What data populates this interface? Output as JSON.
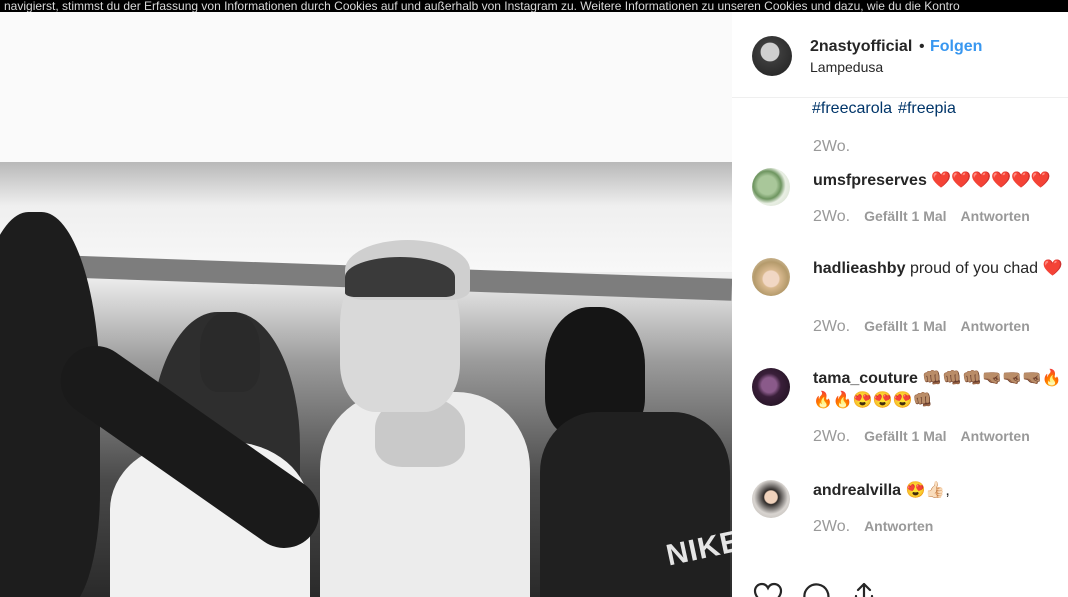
{
  "cookie_banner": {
    "text": "navigierst, stimmst du der Erfassung von Informationen durch Cookies auf und außerhalb von Instagram zu. Weitere Informationen zu unseren Cookies und dazu, wie du die Kontro"
  },
  "photo": {
    "shirt_text": "NIKE"
  },
  "post": {
    "username": "2nastyofficial",
    "separator": "•",
    "follow_label": "Folgen",
    "location": "Lampedusa"
  },
  "caption": {
    "hashtags": [
      "#freecarola",
      "#freepia"
    ],
    "time": "2Wo."
  },
  "comments": [
    {
      "username": "umsfpreserves",
      "text": "❤️❤️❤️❤️❤️❤️",
      "time": "2Wo.",
      "likes": "Gefällt 1 Mal",
      "reply": "Antworten"
    },
    {
      "username": "hadlieashby",
      "text": "proud of you chad ❤️",
      "time": "2Wo.",
      "likes": "Gefällt 1 Mal",
      "reply": "Antworten"
    },
    {
      "username": "tama_couture",
      "text": "👊🏽👊🏽👊🏽🤜🏽🤜🏽🤜🏽🔥🔥🔥😍😍😍👊🏽",
      "time": "2Wo.",
      "likes": "Gefällt 1 Mal",
      "reply": "Antworten"
    },
    {
      "username": "andrealvilla",
      "text": "😍👍🏻,",
      "time": "2Wo.",
      "likes": "",
      "reply": "Antworten"
    }
  ],
  "action_icons": [
    "heart-icon",
    "comment-icon",
    "share-icon"
  ]
}
